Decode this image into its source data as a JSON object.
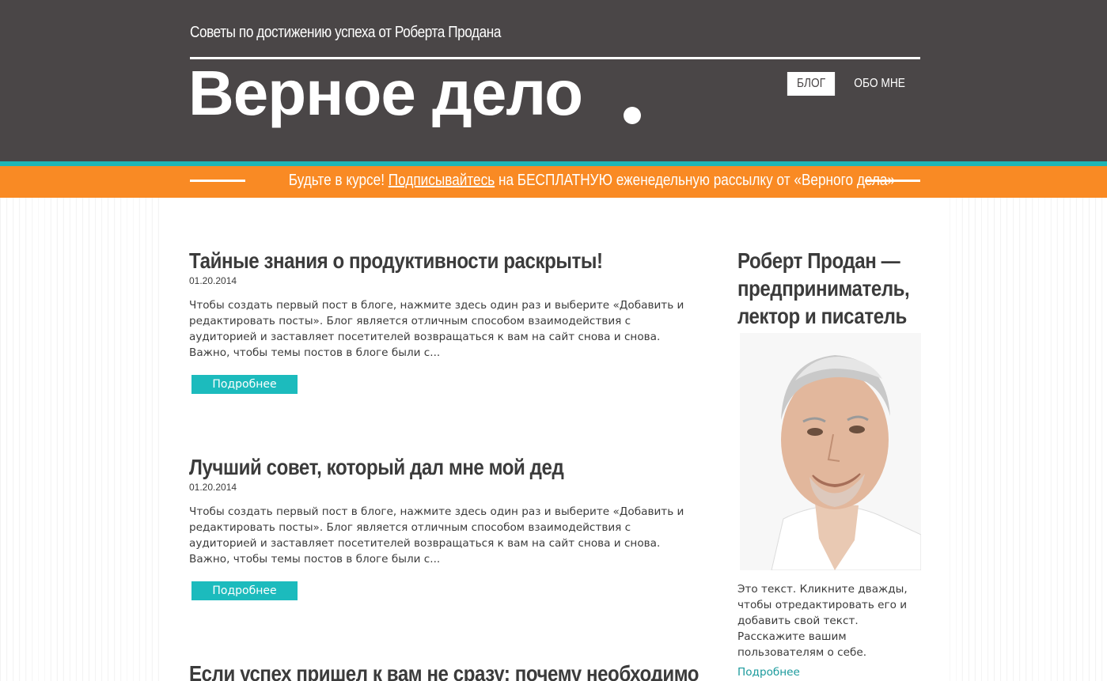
{
  "header": {
    "tagline": "Советы по достижению успеха от Роберта Продана",
    "site_title": "Верное дело",
    "nav": [
      {
        "label": "БЛОГ",
        "active": true
      },
      {
        "label": "ОБО МНЕ",
        "active": false
      }
    ]
  },
  "banner": {
    "text_before": "Будьте в курсе! ",
    "link_text": "Подписывайтесь",
    "text_after": " на БЕСПЛАТНУЮ еженедельную рассылку от «Верного дела»"
  },
  "posts": [
    {
      "title": "Тайные знания о продуктивности раскрыты!",
      "date": "01.20.2014",
      "excerpt": "Чтобы создать первый пост в блоге, нажмите здесь один раз и выберите «Добавить и редактировать посты». Блог является отличным способом взаимодействия с аудиторией и заставляет посетителей возвращаться к вам на сайт снова и снова. Важно, чтобы темы постов в блоге были с...",
      "button": "Подробнее"
    },
    {
      "title": "Лучший совет, который дал мне мой дед",
      "date": "01.20.2014",
      "excerpt": "Чтобы создать первый пост в блоге, нажмите здесь один раз и выберите «Добавить и редактировать посты». Блог является отличным способом взаимодействия с аудиторией и заставляет посетителей возвращаться к вам на сайт снова и снова. Важно, чтобы темы постов в блоге были с...",
      "button": "Подробнее"
    },
    {
      "title": "Если успех пришел к вам не сразу: почему необходимо"
    }
  ],
  "sidebar": {
    "title": "Роберт Продан — предприниматель, лектор и писатель",
    "text": "Это текст. Кликните дважды, чтобы отредактировать его и добавить свой текст. Расскажите вашим пользователям о себе.",
    "link": "Подробнее"
  },
  "colors": {
    "header_bg": "#4a4647",
    "teal": "#1cbbbd",
    "orange": "#f98a24"
  }
}
